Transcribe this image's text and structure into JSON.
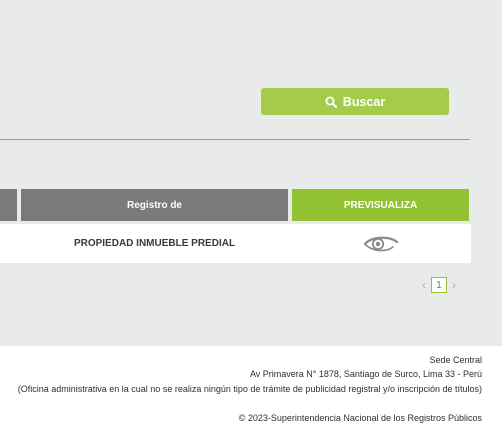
{
  "search": {
    "label": "Buscar",
    "icon": "search-icon"
  },
  "table": {
    "headers": {
      "registro": "Registro de",
      "previsualiza": "PREVISUALIZA"
    },
    "rows": [
      {
        "registro": "PROPIEDAD INMUEBLE PREDIAL",
        "action_icon": "eye-icon"
      }
    ]
  },
  "pagination": {
    "prev": "‹",
    "current": "1",
    "next": "›"
  },
  "footer": {
    "line1": "Sede Central",
    "line2": "Av Primavera N° 1878, Santiago de Surco, Lima 33 - Perú",
    "line3": "(Oficina administrativa en la cual no se realiza ningún tipo de trámite de publicidad registral y/o inscripción de títulos)",
    "copyright": "© 2023-Superintendencia Nacional de los Registros Públicos"
  },
  "colors": {
    "accent": "#a4cb4a",
    "header_gray": "#7a7a7a",
    "header_green": "#93c234"
  }
}
